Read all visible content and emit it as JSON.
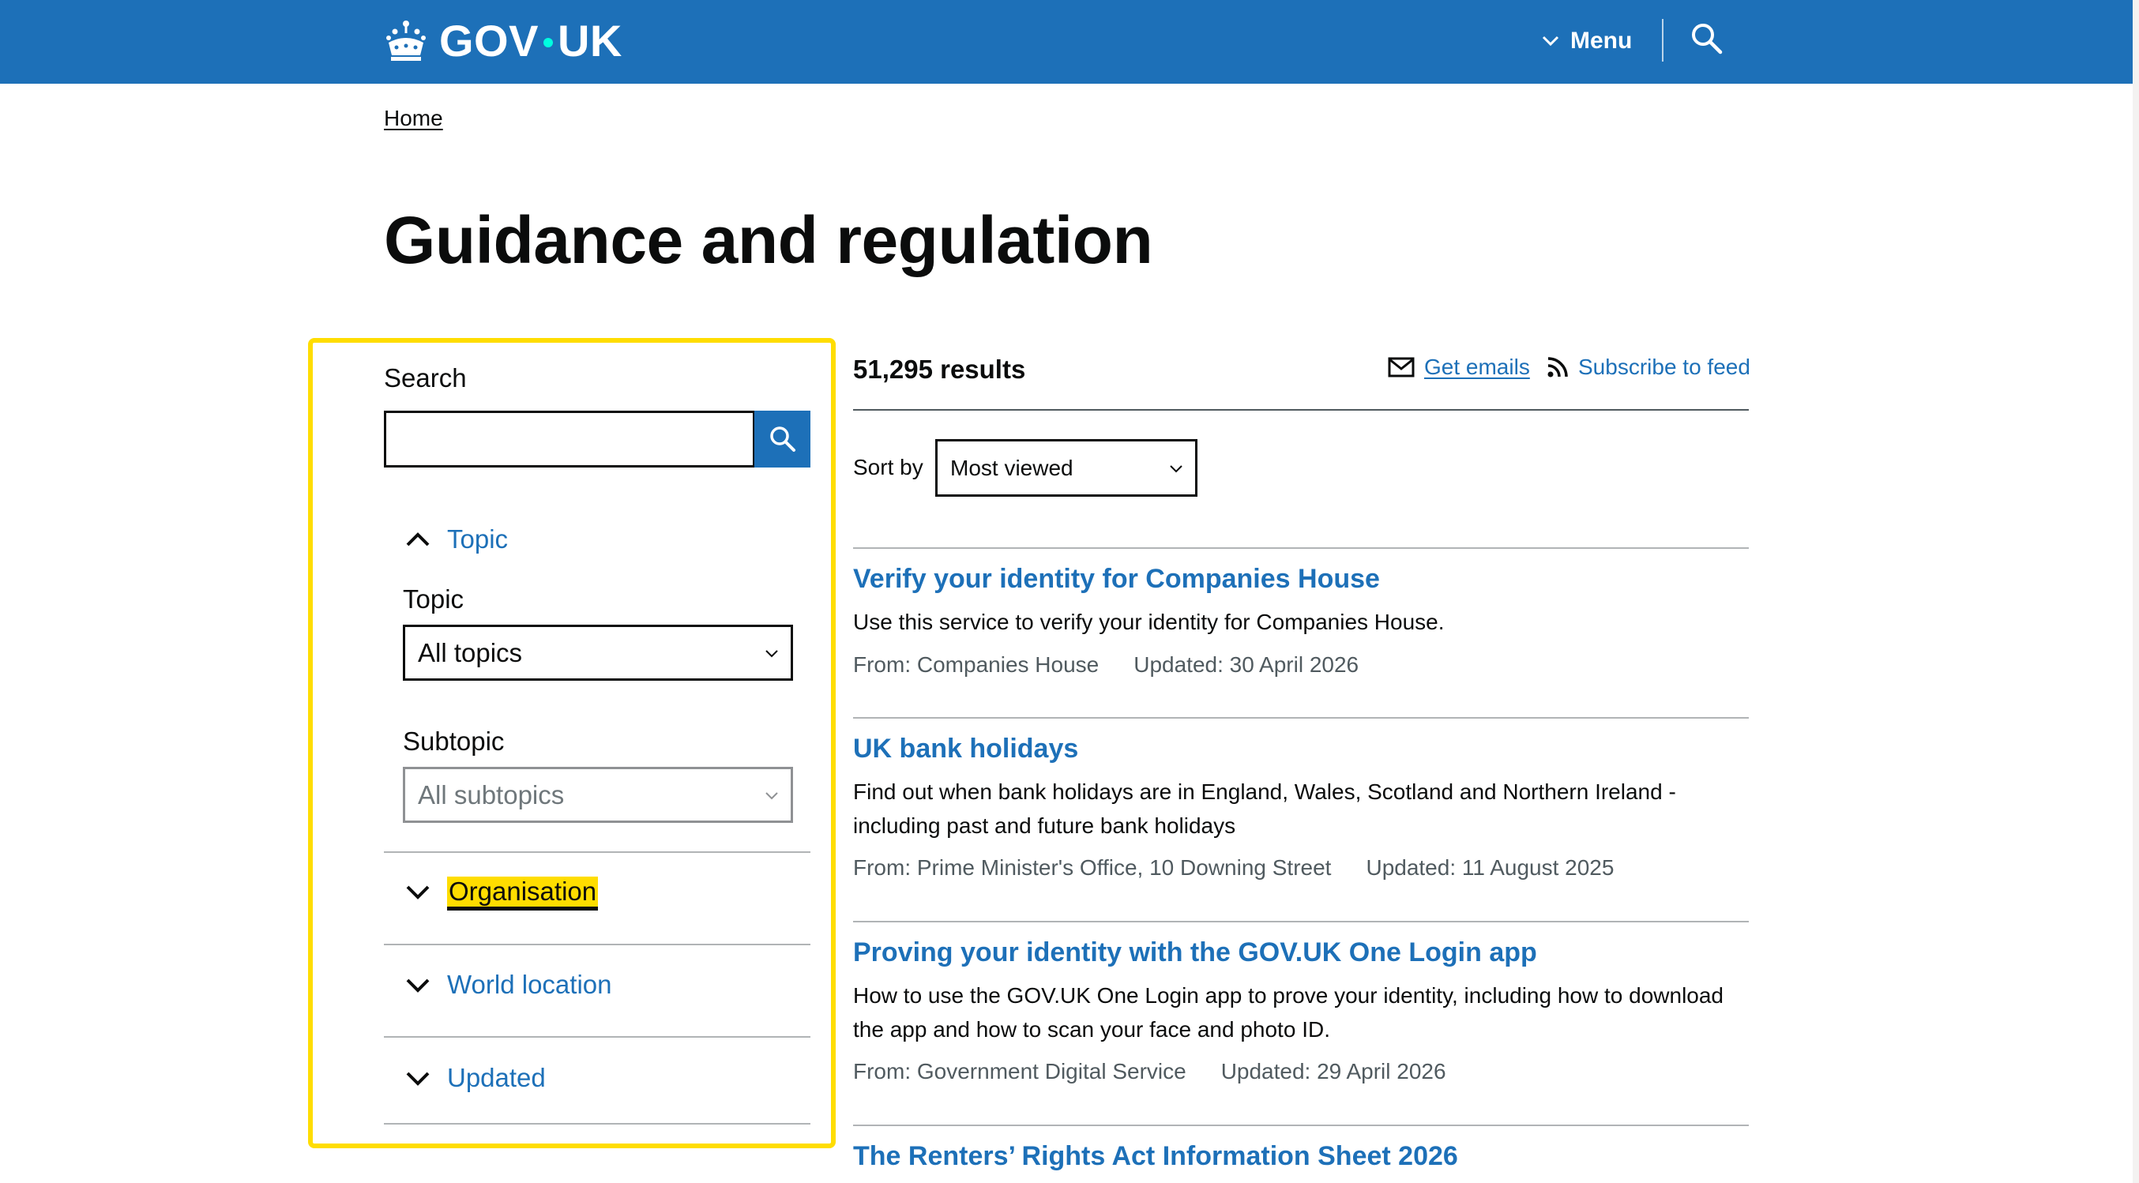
{
  "header": {
    "logo_text_left": "GOV",
    "logo_text_right": "UK",
    "menu_label": "Menu",
    "logo_icon": "crown-icon",
    "search_icon": "search-icon"
  },
  "breadcrumb": {
    "home": "Home"
  },
  "page": {
    "title": "Guidance and regulation"
  },
  "filters": {
    "search_label": "Search",
    "search_value": "",
    "topic_section": "Topic",
    "topic_label": "Topic",
    "topic_value": "All topics",
    "subtopic_label": "Subtopic",
    "subtopic_value": "All subtopics",
    "organisation_section": "Organisation",
    "world_location_section": "World location",
    "updated_section": "Updated"
  },
  "results": {
    "count": "51,295 results",
    "get_emails": "Get emails",
    "subscribe_feed": "Subscribe to feed",
    "sort_label": "Sort by",
    "sort_value": "Most viewed",
    "items": [
      {
        "title": "Verify your identity for Companies House",
        "description": "Use this service to verify your identity for Companies House.",
        "from": "From: Companies House",
        "updated": "Updated: 30 April 2026"
      },
      {
        "title": "UK bank holidays",
        "description": "Find out when bank holidays are in England, Wales, Scotland and Northern Ireland - including past and future bank holidays",
        "from": "From: Prime Minister's Office, 10 Downing Street",
        "updated": "Updated: 11 August 2025"
      },
      {
        "title": "Proving your identity with the GOV.UK One Login app",
        "description": "How to use the GOV.UK One Login app to prove your identity, including how to download the app and how to scan your face and photo ID.",
        "from": "From: Government Digital Service",
        "updated": "Updated: 29 April 2026"
      },
      {
        "title": "The Renters’ Rights Act Information Sheet 2026"
      }
    ]
  },
  "colors": {
    "brand_blue": "#1d70b8",
    "focus_yellow": "#ffdd00",
    "text": "#0b0c0c",
    "secondary_text": "#505a5f"
  }
}
